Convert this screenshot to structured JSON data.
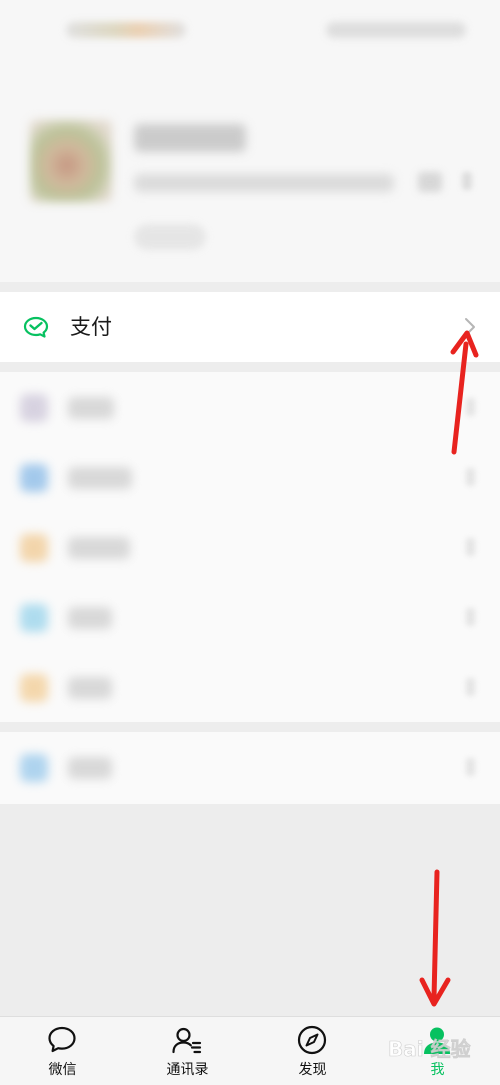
{
  "pay_row": {
    "label": "支付",
    "icon": "wechat-pay-wallet-icon",
    "icon_color": "#07c160"
  },
  "tabs": [
    {
      "label": "微信",
      "icon": "chat-bubble-icon",
      "active": false
    },
    {
      "label": "通讯录",
      "icon": "contacts-icon",
      "active": false
    },
    {
      "label": "发现",
      "icon": "compass-icon",
      "active": false
    },
    {
      "label": "我",
      "icon": "person-icon",
      "active": true
    }
  ],
  "watermark": {
    "text": "Bai 经验"
  },
  "colors": {
    "accent": "#07c160",
    "annotation": "#e8231f",
    "page_bg": "#ededed"
  }
}
